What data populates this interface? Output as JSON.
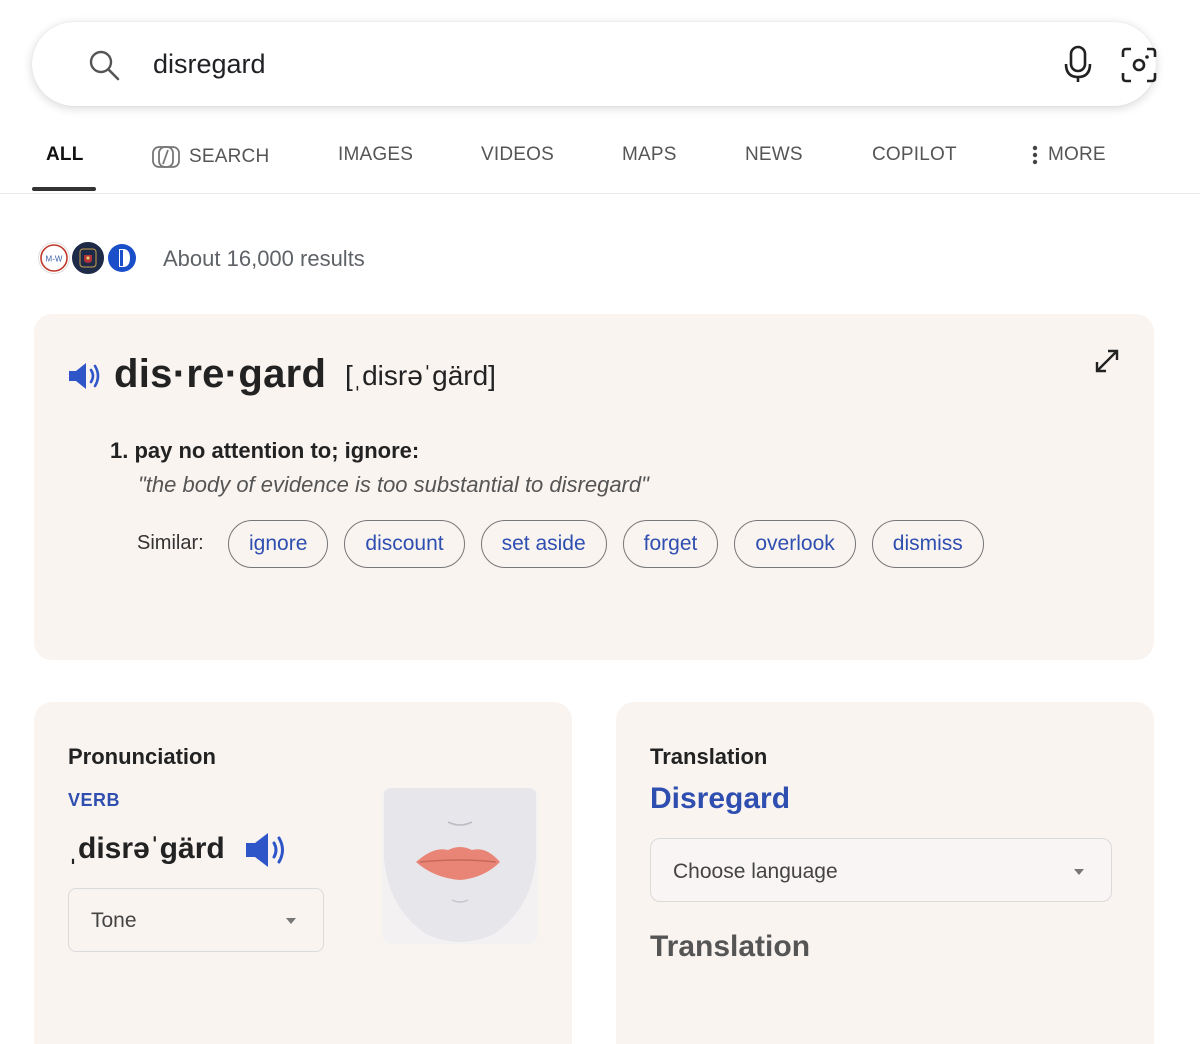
{
  "search": {
    "query": "disregard"
  },
  "tabs": [
    {
      "label": "ALL",
      "active": true
    },
    {
      "label": "SEARCH",
      "active": false
    },
    {
      "label": "IMAGES",
      "active": false
    },
    {
      "label": "VIDEOS",
      "active": false
    },
    {
      "label": "MAPS",
      "active": false
    },
    {
      "label": "NEWS",
      "active": false
    },
    {
      "label": "COPILOT",
      "active": false
    },
    {
      "label": "MORE",
      "active": false
    }
  ],
  "results": {
    "count_text": "About 16,000 results",
    "source_badge_mw": "M-W"
  },
  "definition": {
    "headword": "dis·re·gard",
    "ipa": "[ˌdisrəˈgärd]",
    "sense": "1. pay no attention to; ignore:",
    "example": "\"the body of evidence is too substantial to disregard\"",
    "similar_label": "Similar:",
    "similar": [
      "ignore",
      "discount",
      "set aside",
      "forget",
      "overlook",
      "dismiss"
    ]
  },
  "pronunciation": {
    "title": "Pronunciation",
    "part_of_speech": "VERB",
    "ipa": "ˌdisrəˈgärd",
    "tone_label": "Tone"
  },
  "translation": {
    "title": "Translation",
    "word": "Disregard",
    "language_placeholder": "Choose language",
    "output_label": "Translation"
  },
  "colors": {
    "accent_blue": "#2f4fb0",
    "card_bg": "#faf4f1"
  }
}
